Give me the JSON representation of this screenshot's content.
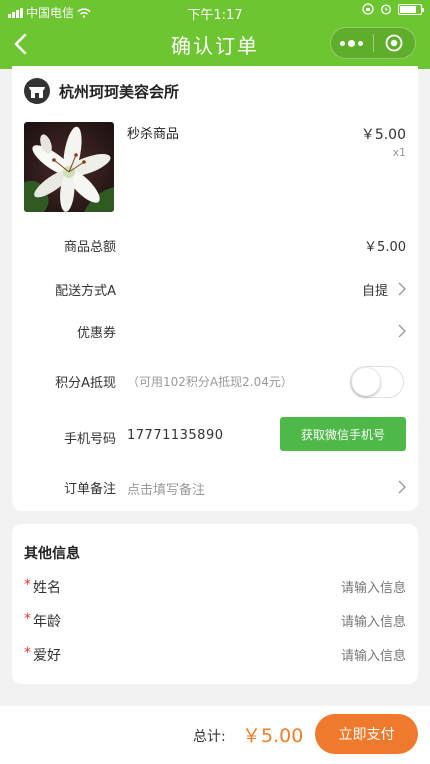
{
  "status": {
    "carrier": "中国电信",
    "time": "下午1:17"
  },
  "nav": {
    "title": "确认订单",
    "back_icon": "chevron-left-icon",
    "more_icon": "more-dots-icon",
    "target_icon": "target-icon"
  },
  "shop": {
    "icon": "store-icon",
    "name": "杭州珂珂美容会所"
  },
  "product": {
    "name": "秒杀商品",
    "price": "￥5.00",
    "qty": "x1",
    "image": "white-lily-image"
  },
  "rows": {
    "total": {
      "label": "商品总额",
      "value": "￥5.00"
    },
    "delivery": {
      "label": "配送方式A",
      "value": "自提"
    },
    "coupon": {
      "label": "优惠券"
    },
    "points": {
      "label": "积分A抵现",
      "hint": "（可用102积分A抵现2.04元）",
      "enabled": false
    },
    "phone": {
      "label": "手机号码",
      "value": "17771135890",
      "button": "获取微信手机号"
    },
    "remark": {
      "label": "订单备注",
      "placeholder": "点击填写备注"
    }
  },
  "other": {
    "title": "其他信息",
    "fields": [
      {
        "label": "姓名",
        "placeholder": "请输入信息"
      },
      {
        "label": "年龄",
        "placeholder": "请输入信息"
      },
      {
        "label": "爱好",
        "placeholder": "请输入信息"
      }
    ]
  },
  "footer": {
    "total_label": "总计:",
    "total_value": "￥5.00",
    "pay_label": "立即支付"
  },
  "colors": {
    "header": "#6cc531",
    "accent_orange": "#ef7a2e",
    "wx_green": "#4eb848",
    "required_red": "#e0372f"
  }
}
